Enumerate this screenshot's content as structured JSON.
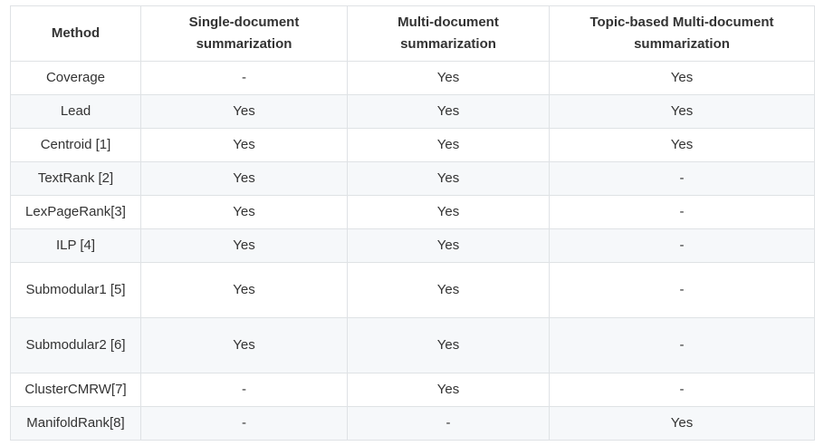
{
  "table": {
    "headers": [
      "Method",
      "Single-document summarization",
      "Multi-document summarization",
      "Topic-based Multi-document summarization"
    ],
    "rows": [
      [
        "Coverage",
        "-",
        "Yes",
        "Yes"
      ],
      [
        "Lead",
        "Yes",
        "Yes",
        "Yes"
      ],
      [
        "Centroid [1]",
        "Yes",
        "Yes",
        "Yes"
      ],
      [
        "TextRank [2]",
        "Yes",
        "Yes",
        "-"
      ],
      [
        "LexPageRank[3]",
        "Yes",
        "Yes",
        "-"
      ],
      [
        "ILP [4]",
        "Yes",
        "Yes",
        "-"
      ],
      [
        "Submodular1 [5]",
        "Yes",
        "Yes",
        "-"
      ],
      [
        "Submodular2 [6]",
        "Yes",
        "Yes",
        "-"
      ],
      [
        "ClusterCMRW[7]",
        "-",
        "Yes",
        "-"
      ],
      [
        "ManifoldRank[8]",
        "-",
        "-",
        "Yes"
      ]
    ]
  }
}
